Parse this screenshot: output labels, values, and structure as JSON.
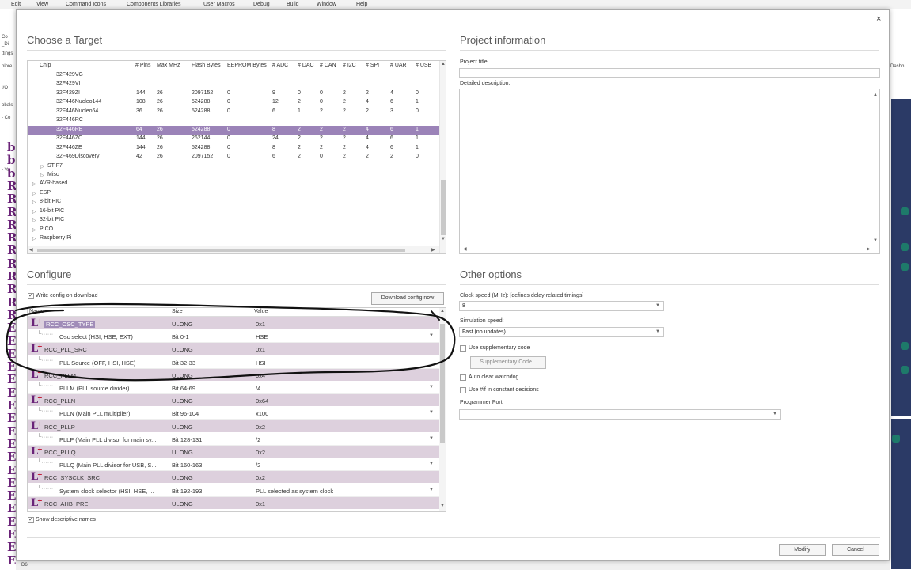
{
  "menubar": [
    "Edit",
    "View",
    "Command Icons",
    "Components Libraries",
    "User Macros",
    "Debug",
    "Build",
    "Window",
    "Help"
  ],
  "bg_left_text": [
    "Co",
    "_Dil",
    "ttings",
    "plore",
    "I/O",
    "obals",
    "- Co",
    "- Va"
  ],
  "bg_right_text": [
    "Dashb",
    "D"
  ],
  "bg_bottom": {
    "combo_value": "D6"
  },
  "dialog": {
    "close": "×"
  },
  "target": {
    "title": "Choose a Target",
    "columns": [
      "Chip",
      "# Pins",
      "Max MHz",
      "Flash Bytes",
      "EEPROM Bytes",
      "# ADC",
      "# DAC",
      "# CAN",
      "# I2C",
      "# SPI",
      "# UART",
      "# USB"
    ],
    "rows": [
      {
        "indent": 2,
        "name": "32F429VG",
        "vals": []
      },
      {
        "indent": 2,
        "name": "32F429VI",
        "vals": []
      },
      {
        "indent": 2,
        "name": "32F429ZI",
        "vals": [
          "144",
          "26",
          "2097152",
          "0",
          "9",
          "0",
          "0",
          "2",
          "2",
          "4",
          "0"
        ]
      },
      {
        "indent": 2,
        "name": "32F446Nucleo144",
        "vals": [
          "108",
          "26",
          "524288",
          "0",
          "12",
          "2",
          "0",
          "2",
          "4",
          "6",
          "1"
        ]
      },
      {
        "indent": 2,
        "name": "32F446Nucleo64",
        "vals": [
          "36",
          "26",
          "524288",
          "0",
          "6",
          "1",
          "2",
          "2",
          "2",
          "3",
          "0"
        ]
      },
      {
        "indent": 2,
        "name": "32F446RC",
        "vals": []
      },
      {
        "indent": 2,
        "name": "32F446RE",
        "vals": [
          "64",
          "26",
          "524288",
          "0",
          "8",
          "2",
          "2",
          "2",
          "4",
          "6",
          "1"
        ],
        "selected": true
      },
      {
        "indent": 2,
        "name": "32F446ZC",
        "vals": [
          "144",
          "26",
          "262144",
          "0",
          "24",
          "2",
          "2",
          "2",
          "4",
          "6",
          "1"
        ]
      },
      {
        "indent": 2,
        "name": "32F446ZE",
        "vals": [
          "144",
          "26",
          "524288",
          "0",
          "8",
          "2",
          "2",
          "2",
          "4",
          "6",
          "1"
        ]
      },
      {
        "indent": 2,
        "name": "32F469Discovery",
        "vals": [
          "42",
          "26",
          "2097152",
          "0",
          "6",
          "2",
          "0",
          "2",
          "2",
          "2",
          "0"
        ]
      },
      {
        "indent": 1,
        "name": "ST F7",
        "vals": [],
        "collapsed": true
      },
      {
        "indent": 1,
        "name": "Misc",
        "vals": [],
        "collapsed": true
      },
      {
        "indent": 0,
        "name": "AVR-based",
        "vals": [],
        "collapsed": true
      },
      {
        "indent": 0,
        "name": "ESP",
        "vals": [],
        "collapsed": true
      },
      {
        "indent": 0,
        "name": "8-bit PIC",
        "vals": [],
        "collapsed": true
      },
      {
        "indent": 0,
        "name": "16-bit PIC",
        "vals": [],
        "collapsed": true
      },
      {
        "indent": 0,
        "name": "32-bit PIC",
        "vals": [],
        "collapsed": true
      },
      {
        "indent": 0,
        "name": "PICO",
        "vals": [],
        "collapsed": true
      },
      {
        "indent": 0,
        "name": "Raspberry Pi",
        "vals": [],
        "collapsed": true
      }
    ]
  },
  "project": {
    "title": "Project information",
    "title_label": "Project title:",
    "desc_label": "Detailed description:"
  },
  "configure": {
    "title": "Configure",
    "write_config_label": "Write config on download",
    "write_config_checked": true,
    "download_button": "Download config now",
    "columns": [
      "Name",
      "Size",
      "Value"
    ],
    "rows": [
      {
        "kind": "param",
        "name": "RCC_OSC_TYPE",
        "size": "ULONG",
        "value": "0x1",
        "selected": true
      },
      {
        "kind": "bit",
        "name": "Osc select (HSI, HSE, EXT)",
        "size": "Bit 0-1",
        "value": "HSE",
        "dropdown": true
      },
      {
        "kind": "param",
        "name": "RCC_PLL_SRC",
        "size": "ULONG",
        "value": "0x1"
      },
      {
        "kind": "bit",
        "name": "PLL Source (OFF, HSI, HSE)",
        "size": "Bit 32-33",
        "value": "HSI"
      },
      {
        "kind": "param",
        "name": "RCC_PLLM",
        "size": "ULONG",
        "value": "0x4"
      },
      {
        "kind": "bit",
        "name": "PLLM (PLL source divider)",
        "size": "Bit 64-69",
        "value": "/4",
        "dropdown": true
      },
      {
        "kind": "param",
        "name": "RCC_PLLN",
        "size": "ULONG",
        "value": "0x64"
      },
      {
        "kind": "bit",
        "name": "PLLN (Main PLL multiplier)",
        "size": "Bit 96-104",
        "value": "x100",
        "dropdown": true
      },
      {
        "kind": "param",
        "name": "RCC_PLLP",
        "size": "ULONG",
        "value": "0x2"
      },
      {
        "kind": "bit",
        "name": "PLLP (Main PLL divisor for main sy...",
        "size": "Bit 128-131",
        "value": "/2",
        "dropdown": true
      },
      {
        "kind": "param",
        "name": "RCC_PLLQ",
        "size": "ULONG",
        "value": "0x2"
      },
      {
        "kind": "bit",
        "name": "PLLQ (Main PLL divisor for USB, S...",
        "size": "Bit 160-163",
        "value": "/2",
        "dropdown": true
      },
      {
        "kind": "param",
        "name": "RCC_SYSCLK_SRC",
        "size": "ULONG",
        "value": "0x2"
      },
      {
        "kind": "bit",
        "name": "System clock selector (HSI, HSE, ...",
        "size": "Bit 192-193",
        "value": "PLL selected as system clock",
        "dropdown": true
      },
      {
        "kind": "param",
        "name": "RCC_AHB_PRE",
        "size": "ULONG",
        "value": "0x1"
      }
    ],
    "show_descriptive_label": "Show descriptive names",
    "show_descriptive_checked": true
  },
  "other": {
    "title": "Other options",
    "clock_label": "Clock speed (MHz): [defines delay-related timings]",
    "clock_value": "8",
    "sim_label": "Simulation speed:",
    "sim_value": "Fast (no updates)",
    "supp_label": "Use supplementary code",
    "supp_button": "Supplementary Code...",
    "watchdog_label": "Auto clear watchdog",
    "ifdef_label": "Use #if in constant decisions",
    "programmer_label": "Programmer Port:",
    "programmer_value": ""
  },
  "footer": {
    "modify": "Modify",
    "cancel": "Cancel"
  },
  "icons": {
    "close": "close-icon",
    "expand": "expand-triangle-icon",
    "param": "parameter-L-plus-icon",
    "dropdown": "chevron-down-icon"
  },
  "colors": {
    "selected_row": "#9b83b8",
    "param_row": "#ddd0dd",
    "brand": "#6a2378",
    "panel_dark": "#2b3a66"
  }
}
